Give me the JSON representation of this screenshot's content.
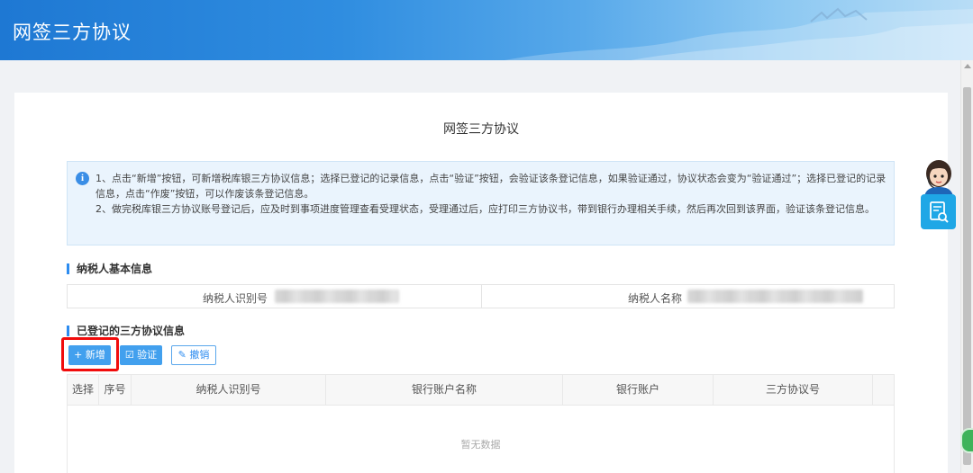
{
  "header": {
    "title": "网签三方协议"
  },
  "page": {
    "title": "网签三方协议"
  },
  "notice": {
    "lines": [
      "1、点击“新增”按钮，可新增税库银三方协议信息；选择已登记的记录信息，点击“验证”按钮，会验证该条登记信息，如果验证通过，协议状态会变为“验证通过”；选择已登记的记录信息，点击“作废”按钮，可以作废该条登记信息。",
      "2、做完税库银三方协议账号登记后，应及时到事项进度管理查看受理状态，受理通过后，应打印三方协议书，带到银行办理相关手续，然后再次回到该界面，验证该条登记信息。"
    ]
  },
  "taxpayer": {
    "section_title": "纳税人基本信息",
    "id_label": "纳税人识别号",
    "name_label": "纳税人名称"
  },
  "agreements": {
    "section_title": "已登记的三方协议信息",
    "buttons": {
      "add": "+ 新增",
      "verify": "☑ 验证",
      "cancel": "✎ 撤销"
    },
    "columns": [
      "选择",
      "序号",
      "纳税人识别号",
      "银行账户名称",
      "银行账户",
      "三方协议号"
    ],
    "empty_text": "暂无数据"
  },
  "colors": {
    "brand": "#2d8cf0",
    "header": "#1e78d3",
    "highlight": "#f10c0c"
  }
}
